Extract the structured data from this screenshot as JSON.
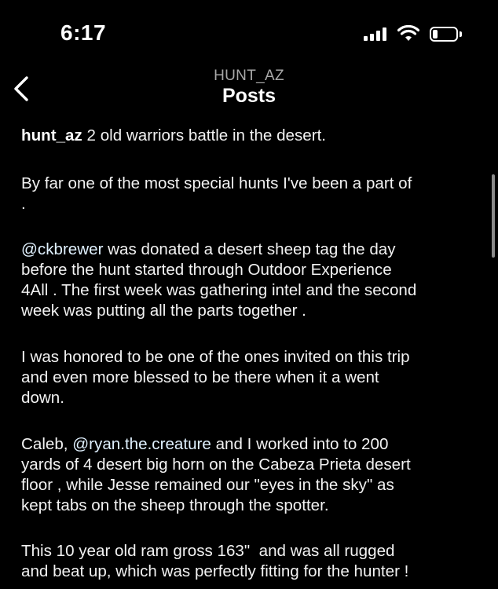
{
  "status": {
    "time": "6:17"
  },
  "nav": {
    "subtitle": "HUNT_AZ",
    "title": "Posts"
  },
  "caption": {
    "username": "hunt_az",
    "line1": "2 old warriors battle in the desert.",
    "p2_l1": " By far one of the most special hunts I've been a part of",
    "p2_l2": ".",
    "mention1": "@ckbrewer",
    "p3_l1_rest": " was donated a desert sheep tag the day",
    "p3_l2": "before the hunt started through Outdoor Experience",
    "p3_l3": "4All . The first week was gathering intel and the second",
    "p3_l4": "week was putting all the parts together .",
    "p4_l1": "I was honored to be one of the ones invited on this trip",
    "p4_l2": "and even more blessed to be there when it a went",
    "p4_l3": "down.",
    "p5_l1_pre": "Caleb, ",
    "mention2": "@ryan.the.creature",
    "p5_l1_rest": " and I worked into to 200",
    "p5_l2": "yards of 4 desert big horn on the Cabeza Prieta desert",
    "p5_l3": "floor , while Jesse remained our \"eyes in the sky\" as",
    "p5_l4": "kept tabs on the sheep through the spotter.",
    "p6_l1": "This 10 year old ram gross 163\"  and was all rugged",
    "p6_l2": "and beat up, which was perfectly fitting for the hunter !"
  }
}
